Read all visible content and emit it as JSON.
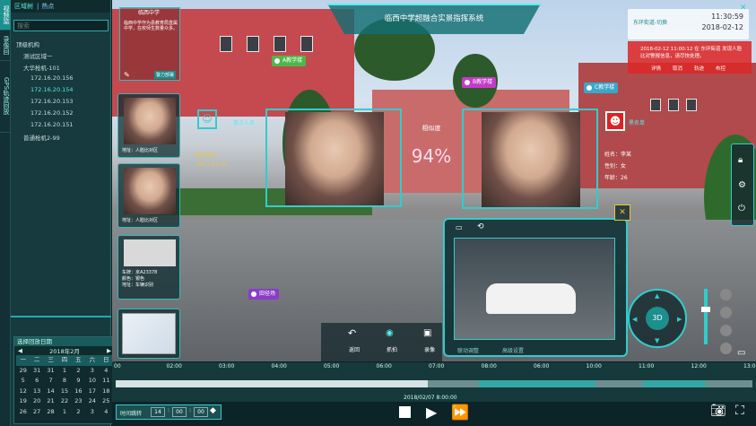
{
  "nav": {
    "tabs": [
      "视频监控",
      "录像回放",
      "GPS轨迹回放"
    ]
  },
  "left": {
    "tabs": [
      "区域树",
      "热点"
    ],
    "search_placeholder": "搜索",
    "tree": [
      {
        "label": "顶级机构",
        "indent": 0,
        "sel": false
      },
      {
        "label": "测试区域一",
        "indent": 1,
        "sel": false
      },
      {
        "label": "大华枪机-101",
        "indent": 1,
        "sel": false
      },
      {
        "label": "172.16.20.156",
        "indent": 2,
        "sel": false
      },
      {
        "label": "172.16.20.154",
        "indent": 2,
        "sel": true
      },
      {
        "label": "172.16.20.153",
        "indent": 2,
        "sel": false
      },
      {
        "label": "172.16.20.152",
        "indent": 2,
        "sel": false
      },
      {
        "label": "172.16.20.151",
        "indent": 2,
        "sel": false
      },
      {
        "label": "普通枪机2-99",
        "indent": 1,
        "sel": false
      }
    ],
    "calendar": {
      "header": "选择回放日期",
      "month": "2018年2月",
      "weekdays": [
        "一",
        "二",
        "三",
        "四",
        "五",
        "六",
        "日"
      ],
      "days": [
        [
          "29",
          "31",
          "31",
          "1",
          "2",
          "3",
          "4"
        ],
        [
          "5",
          "6",
          "7",
          "8",
          "9",
          "10",
          "11"
        ],
        [
          "12",
          "13",
          "14",
          "15",
          "16",
          "17",
          "18"
        ],
        [
          "19",
          "20",
          "21",
          "22",
          "23",
          "24",
          "25"
        ],
        [
          "26",
          "27",
          "28",
          "1",
          "2",
          "3",
          "4"
        ]
      ]
    }
  },
  "scene": {
    "title": "临西中学超融合实景指挥系统",
    "clock": {
      "time": "11:30:59",
      "date": "2018-02-12",
      "location": "东环街道-切换"
    },
    "alert": {
      "message": "2018-02-12 11:00:12 在 东环街道 发现人脸比对警报信息，请尽快处理。",
      "buttons": [
        "详情",
        "取消",
        "轨迹",
        "布控"
      ]
    },
    "info_label": "临西中学",
    "info_text": "临西中学作为县教育局直属中学，在校师生数量众多。",
    "info_button": "警力部署",
    "pins": [
      {
        "label": "A教学楼",
        "color": "#4db848"
      },
      {
        "label": "B教学楼",
        "color": "#c23cc9"
      },
      {
        "label": "C教学楼",
        "color": "#3aa6c9"
      },
      {
        "label": "田径场",
        "color": "#8a3cc9"
      }
    ],
    "cards": [
      {
        "l1": "地址：人脸比对区",
        "l2": ""
      },
      {
        "l1": "地址：人脸比对区",
        "l2": ""
      },
      {
        "l1": "车牌：京A23378",
        "l2": "颜色：银色",
        "l3": "地址：车辆识别"
      },
      {
        "l1": "",
        "l2": ""
      }
    ],
    "left_face": {
      "label": "重点人员",
      "time_label": "抓拍时间：",
      "time": "2017-12-12"
    },
    "match": {
      "label": "相似度",
      "value": "94%"
    },
    "right_face": {
      "label": "黑名单",
      "name": "姓名：李某",
      "sex": "性别：女",
      "age": "年龄：26"
    },
    "toolbar": [
      "返回",
      "抓拍",
      "录像"
    ],
    "pip": {
      "tabs": [
        "联动调整",
        "高级设置"
      ]
    },
    "joystick": "3D"
  },
  "timeline": {
    "ticks": [
      "00",
      "02:00",
      "03:00",
      "04:00",
      "05:00",
      "06:00",
      "07:00",
      "08:00",
      "06:00",
      "10:00",
      "11:00",
      "12:00",
      "13:00"
    ],
    "current": "2018/02/07 8:00:00",
    "progress": 0.49,
    "time_label": "时间跳转",
    "h": "14",
    "m": "00",
    "s": "00"
  },
  "colors": {
    "accent": "#35c9c6",
    "alert": "#dc2828"
  }
}
